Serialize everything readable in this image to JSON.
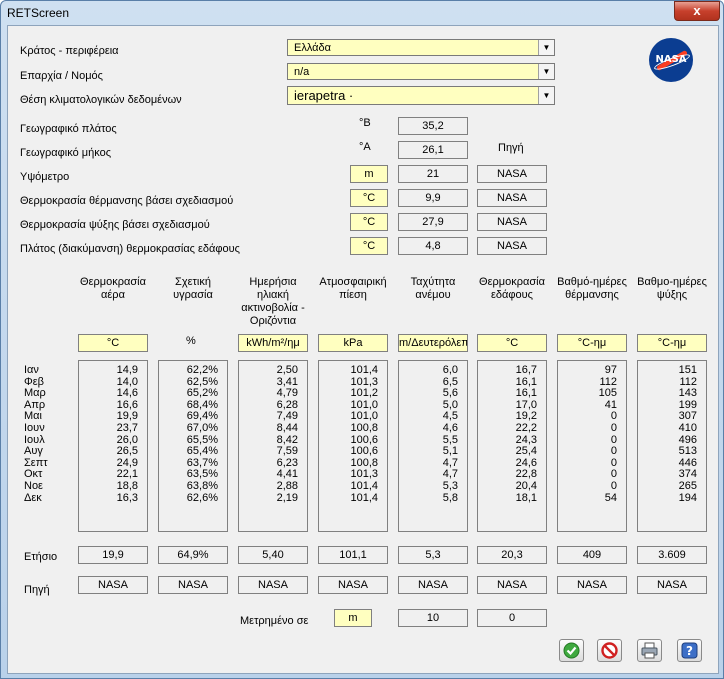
{
  "window": {
    "title": "RETScreen",
    "close_glyph": "x"
  },
  "location": {
    "country_label": "Κράτος - περιφέρεια",
    "country_value": "Ελλάδα",
    "province_label": "Επαρχία / Νομός",
    "province_value": "n/a",
    "site_label": "Θέση κλιματολογικών δεδομένων",
    "site_value": "ierapetra ·"
  },
  "coords": {
    "lat_label": "Γεωγραφικό πλάτος",
    "lat_unit": "°B",
    "lat_value": "35,2",
    "lon_label": "Γεωγραφικό μήκος",
    "lon_unit": "°A",
    "lon_value": "26,1",
    "source_header": "Πηγή",
    "elev_label": "Υψόμετρο",
    "elev_unit": "m",
    "elev_value": "21",
    "elev_source": "NASA",
    "heat_label": "Θερμοκρασία θέρμανσης βάσει σχεδιασμού",
    "heat_unit": "°C",
    "heat_value": "9,9",
    "heat_source": "NASA",
    "cool_label": "Θερμοκρασία ψύξης βάσει σχεδιασμού",
    "cool_unit": "°C",
    "cool_value": "27,9",
    "cool_source": "NASA",
    "range_label": "Πλάτος (διακύμανση) θερμοκρασίας εδάφους",
    "range_unit": "°C",
    "range_value": "4,8",
    "range_source": "NASA"
  },
  "columns": [
    {
      "header": "Θερμοκρασία αέρα",
      "unit": "°C",
      "unit_boxed": true,
      "values": [
        "14,9",
        "14,0",
        "14,6",
        "16,6",
        "19,9",
        "23,7",
        "26,0",
        "26,5",
        "24,9",
        "22,1",
        "18,8",
        "16,3"
      ],
      "annual": "19,9",
      "source": "NASA"
    },
    {
      "header": "Σχετική υγρασία",
      "unit": "%",
      "unit_boxed": false,
      "values": [
        "62,2%",
        "62,5%",
        "65,2%",
        "68,4%",
        "69,4%",
        "67,0%",
        "65,5%",
        "65,4%",
        "63,7%",
        "63,5%",
        "63,8%",
        "62,6%"
      ],
      "annual": "64,9%",
      "source": "NASA"
    },
    {
      "header": "Ημερήσια ηλιακή ακτινοβολία - Οριζόντια",
      "unit": "kWh/m²/ημ",
      "unit_boxed": true,
      "values": [
        "2,50",
        "3,41",
        "4,79",
        "6,28",
        "7,49",
        "8,44",
        "8,42",
        "7,59",
        "6,23",
        "4,41",
        "2,88",
        "2,19"
      ],
      "annual": "5,40",
      "source": "NASA"
    },
    {
      "header": "Ατμοσφαιρική πίεση",
      "unit": "kPa",
      "unit_boxed": true,
      "values": [
        "101,4",
        "101,3",
        "101,2",
        "101,0",
        "101,0",
        "100,8",
        "100,6",
        "100,6",
        "100,8",
        "101,3",
        "101,4",
        "101,4"
      ],
      "annual": "101,1",
      "source": "NASA"
    },
    {
      "header": "Ταχύτητα ανέμου",
      "unit": "m/Δευτερόλεπτο",
      "unit_boxed": true,
      "values": [
        "6,0",
        "6,5",
        "5,6",
        "5,0",
        "4,5",
        "4,6",
        "5,5",
        "5,1",
        "4,7",
        "4,7",
        "5,3",
        "5,8"
      ],
      "annual": "5,3",
      "source": "NASA"
    },
    {
      "header": "Θερμοκρασία εδάφους",
      "unit": "°C",
      "unit_boxed": true,
      "values": [
        "16,7",
        "16,1",
        "16,1",
        "17,0",
        "19,2",
        "22,2",
        "24,3",
        "25,4",
        "24,6",
        "22,8",
        "20,4",
        "18,1"
      ],
      "annual": "20,3",
      "source": "NASA"
    },
    {
      "header": "Βαθμό-ημέρες θέρμανσης",
      "unit": "°C-ημ",
      "unit_boxed": true,
      "values": [
        "97",
        "112",
        "105",
        "41",
        "0",
        "0",
        "0",
        "0",
        "0",
        "0",
        "0",
        "54"
      ],
      "annual": "409",
      "source": "NASA"
    },
    {
      "header": "Βαθμο-ημέρες ψύξης",
      "unit": "°C-ημ",
      "unit_boxed": true,
      "values": [
        "151",
        "112",
        "143",
        "199",
        "307",
        "410",
        "496",
        "513",
        "446",
        "374",
        "265",
        "194"
      ],
      "annual": "3.609",
      "source": "NASA"
    }
  ],
  "months": [
    "Ιαν",
    "Φεβ",
    "Μαρ",
    "Απρ",
    "Μαι",
    "Ιουν",
    "Ιουλ",
    "Αυγ",
    "Σεπτ",
    "Οκτ",
    "Νοε",
    "Δεκ"
  ],
  "annual_label": "Ετήσιο",
  "source_label": "Πηγή",
  "measured": {
    "label": "Μετρημένο σε",
    "unit": "m",
    "value1": "10",
    "value2": "0"
  },
  "buttons": {
    "ok": "ok-icon",
    "cancel": "cancel-icon",
    "print": "print-icon",
    "help": "help-icon"
  },
  "logo": {
    "text": "NASA"
  },
  "colors": {
    "field_yellow": "#ffffc0",
    "dialog_bg": "#f0f0f0",
    "close_red": "#c7402c"
  }
}
